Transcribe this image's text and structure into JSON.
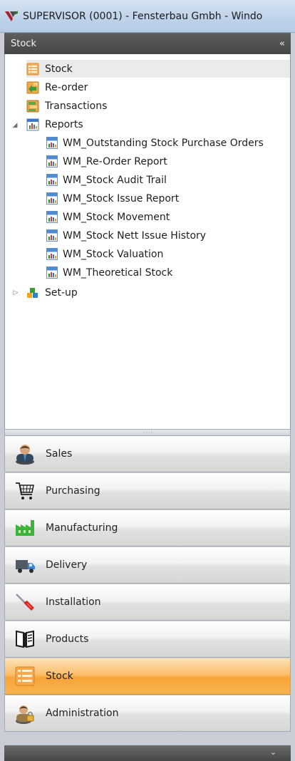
{
  "window": {
    "title": "SUPERVISOR (0001) - Fensterbau Gmbh - Windo"
  },
  "pane": {
    "header": "Stock",
    "collapse_glyph": "«"
  },
  "tree": {
    "items": [
      {
        "label": "Stock",
        "icon": "stock-list-icon",
        "selected": true
      },
      {
        "label": "Re-order",
        "icon": "reorder-icon"
      },
      {
        "label": "Transactions",
        "icon": "transactions-icon"
      },
      {
        "label": "Reports",
        "icon": "reports-icon",
        "expanded": true
      },
      {
        "label": "Set-up",
        "icon": "setup-icon",
        "expanded": false
      }
    ],
    "reports": [
      "WM_Outstanding Stock Purchase Orders",
      "WM_Re-Order Report",
      "WM_Stock Audit Trail",
      "WM_Stock Issue Report",
      "WM_Stock Movement",
      "WM_Stock Nett Issue History",
      "WM_Stock Valuation",
      "WM_Theoretical Stock"
    ]
  },
  "nav": {
    "items": [
      {
        "label": "Sales",
        "icon": "sales-person-icon"
      },
      {
        "label": "Purchasing",
        "icon": "shopping-cart-icon"
      },
      {
        "label": "Manufacturing",
        "icon": "factory-icon"
      },
      {
        "label": "Delivery",
        "icon": "delivery-truck-icon"
      },
      {
        "label": "Installation",
        "icon": "screwdriver-icon"
      },
      {
        "label": "Products",
        "icon": "products-book-icon"
      },
      {
        "label": "Stock",
        "icon": "stock-checklist-icon",
        "active": true
      },
      {
        "label": "Administration",
        "icon": "administrator-icon"
      }
    ]
  },
  "colors": {
    "active_nav": "#f7a436",
    "header_bg": "#4f4f4f",
    "selected_row": "#ebebeb"
  }
}
